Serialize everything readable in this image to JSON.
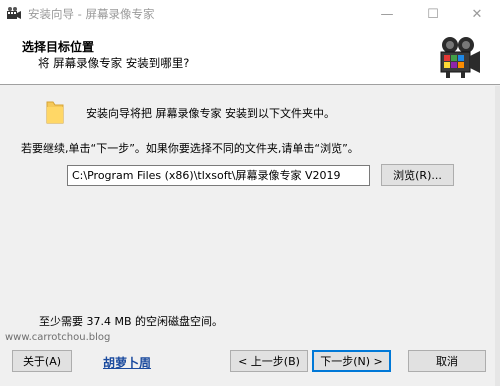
{
  "window": {
    "title": "安装向导 - 屏幕录像专家",
    "min_glyph": "—",
    "max_glyph": "☐",
    "close_glyph": "✕"
  },
  "header": {
    "title": "选择目标位置",
    "subtitle": "将 屏幕录像专家 安装到哪里?"
  },
  "body": {
    "intro": "安装向导将把 屏幕录像专家 安装到以下文件夹中。",
    "instruction": "若要继续,单击“下一步”。如果你要选择不同的文件夹,请单击“浏览”。",
    "path_value": "C:\\Program Files (x86)\\tlxsoft\\屏幕录像专家 V2019",
    "browse_label": "浏览(R)...",
    "space_text": "至少需要 37.4 MB 的空闲磁盘空间。",
    "watermark": "www.carrotchou.blog"
  },
  "footer": {
    "about_label": "关于(A)",
    "link_text": "胡萝卜周",
    "back_label": "< 上一步(B)",
    "next_label": "下一步(N) >",
    "cancel_label": "取消"
  },
  "icons": {
    "app": "film-camera-icon",
    "header": "video-camera-icon",
    "folder": "folder-icon"
  }
}
